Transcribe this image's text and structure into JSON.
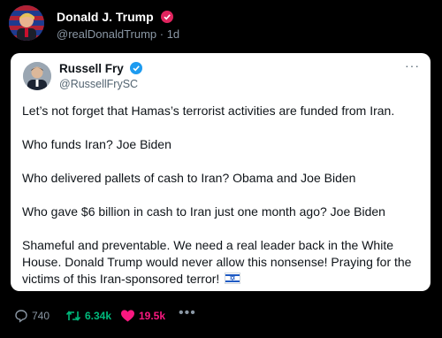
{
  "post": {
    "author_name": "Donald J. Trump",
    "author_handle_time": "@realDonaldTrump · 1d"
  },
  "quoted": {
    "name": "Russell Fry",
    "handle": "@RussellFrySC",
    "more": "···",
    "paragraphs": [
      "Let’s not forget that Hamas’s terrorist activities are funded from Iran.",
      "Who funds Iran? Joe Biden",
      "Who delivered pallets of cash to Iran? Obama and Joe Biden",
      "Who gave $6 billion in cash to Iran just one month ago? Joe Biden"
    ],
    "last_paragraph": "Shameful and preventable. We need a real leader back in the White House. Donald Trump would never allow this nonsense! Praying for the victims of this Iran-sponsored terror!"
  },
  "actions": {
    "replies": "740",
    "reposts": "6.34k",
    "likes": "19.5k",
    "more": "•••"
  },
  "colors": {
    "background": "#000000",
    "card": "#ffffff",
    "verified_blue": "#1d9bf0",
    "badge_pink": "#e0245e",
    "repost_green": "#00ba7c",
    "like_pink": "#f91880"
  },
  "icons": [
    "reply-icon",
    "repost-icon",
    "heart-icon",
    "verified-icon",
    "israel-flag-icon"
  ]
}
